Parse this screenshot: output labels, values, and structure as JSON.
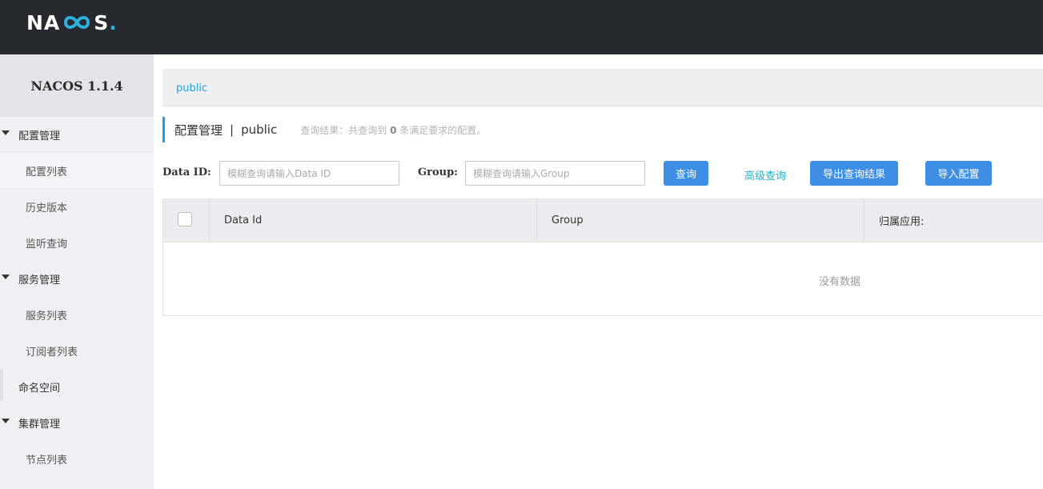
{
  "header": {
    "logo_pre": "NA",
    "logo_post": "S",
    "logo_dot": "."
  },
  "sidebar": {
    "version": "NACOS 1.1.4",
    "groups": [
      {
        "label": "配置管理",
        "items": [
          "配置列表",
          "历史版本",
          "监听查询"
        ]
      },
      {
        "label": "服务管理",
        "items": [
          "服务列表",
          "订阅者列表"
        ]
      },
      {
        "label": "命名空间"
      },
      {
        "label": "集群管理",
        "items": [
          "节点列表"
        ]
      }
    ]
  },
  "breadcrumb": {
    "namespace": "public"
  },
  "page": {
    "title": "配置管理",
    "separator": "|",
    "namespace": "public",
    "hint_prefix": "查询结果：共查询到",
    "hint_count": "0",
    "hint_suffix": "条满足要求的配置。"
  },
  "search": {
    "dataid_label": "Data ID:",
    "dataid_placeholder": "模糊查询请输入Data ID",
    "group_label": "Group:",
    "group_placeholder": "模糊查询请输入Group",
    "query_button": "查询",
    "advanced_link": "高级查询",
    "export_button": "导出查询结果",
    "import_button": "导入配置"
  },
  "table": {
    "columns": [
      "Data Id",
      "Group",
      "归属应用:"
    ],
    "empty_text": "没有数据"
  },
  "colors": {
    "header_bg": "#262a2f",
    "accent": "#3e8ee6",
    "link": "#20b4c9",
    "sidebar_bg": "#eef0f4"
  }
}
